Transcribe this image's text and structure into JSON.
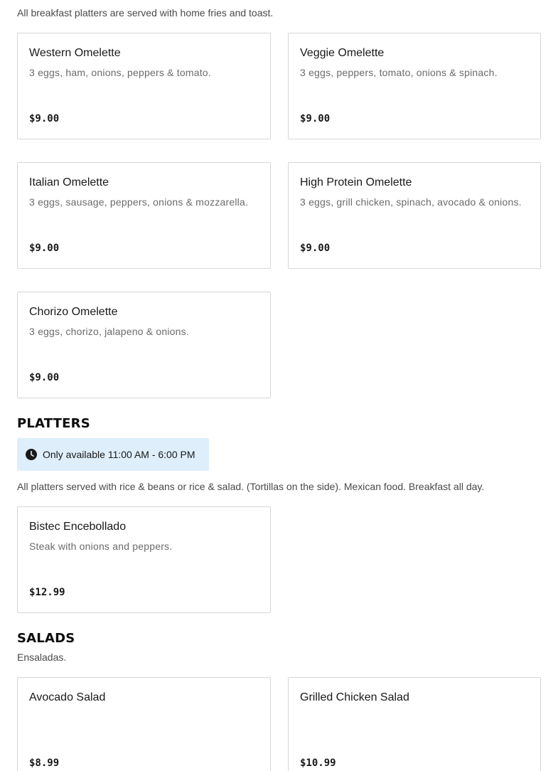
{
  "breakfast": {
    "description": "All breakfast platters are served with home fries and toast.",
    "items": [
      {
        "name": "Western Omelette",
        "description": "3 eggs, ham, onions, peppers & tomato.",
        "price": "$9.00"
      },
      {
        "name": "Veggie Omelette",
        "description": "3 eggs, peppers, tomato, onions & spinach.",
        "price": "$9.00"
      },
      {
        "name": "Italian Omelette",
        "description": "3 eggs, sausage, peppers, onions & mozzarella.",
        "price": "$9.00"
      },
      {
        "name": "High Protein Omelette",
        "description": "3 eggs, grill chicken, spinach, avocado & onions.",
        "price": "$9.00"
      },
      {
        "name": "Chorizo Omelette",
        "description": "3 eggs, chorizo, jalapeno & onions.",
        "price": "$9.00"
      }
    ]
  },
  "platters": {
    "title": "PLATTERS",
    "availability": "Only available 11:00 AM - 6:00 PM",
    "availability_icon": "clock-icon",
    "description": "All platters served with rice & beans or rice & salad. (Tortillas on the side). Mexican food. Breakfast all day.",
    "items": [
      {
        "name": "Bistec Encebollado",
        "description": "Steak with onions and peppers.",
        "price": "$12.99"
      }
    ]
  },
  "salads": {
    "title": "SALADS",
    "description": "Ensaladas.",
    "items": [
      {
        "name": "Avocado Salad",
        "description": "",
        "price": "$8.99"
      },
      {
        "name": "Grilled Chicken Salad",
        "description": "",
        "price": "$10.99"
      }
    ]
  },
  "colors": {
    "badge_background": "#deeefb",
    "card_border": "#d6d6d6",
    "muted_text": "#6b6b6b"
  }
}
